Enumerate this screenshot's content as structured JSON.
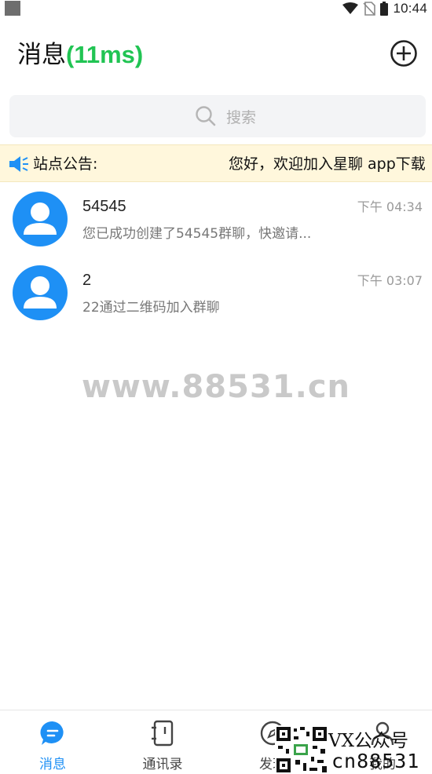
{
  "status_bar": {
    "time": "10:44"
  },
  "header": {
    "title": "消息",
    "latency": "(11ms)"
  },
  "search": {
    "placeholder": "搜索"
  },
  "notice": {
    "label": "站点公告:",
    "text": "您好，欢迎加入星聊  app下载"
  },
  "chats": [
    {
      "name": "54545",
      "time": "下午 04:34",
      "preview": "您已成功创建了54545群聊，快邀请..."
    },
    {
      "name": "2",
      "time": "下午 03:07",
      "preview": "22通过二维码加入群聊"
    }
  ],
  "watermark": "www.88531.cn",
  "bottom_nav": [
    {
      "label": "消息",
      "icon": "chat-bubble-icon",
      "active": true
    },
    {
      "label": "通讯录",
      "icon": "contacts-book-icon",
      "active": false
    },
    {
      "label": "发现",
      "icon": "compass-icon",
      "active": false
    },
    {
      "label": "我的",
      "icon": "user-icon",
      "active": false
    }
  ],
  "overlay": {
    "vx_text": "VX公众号",
    "cn_text": "cn88531"
  },
  "colors": {
    "accent": "#1e90f5",
    "latency_green": "#21c453",
    "notice_bg": "#fff7dc"
  }
}
